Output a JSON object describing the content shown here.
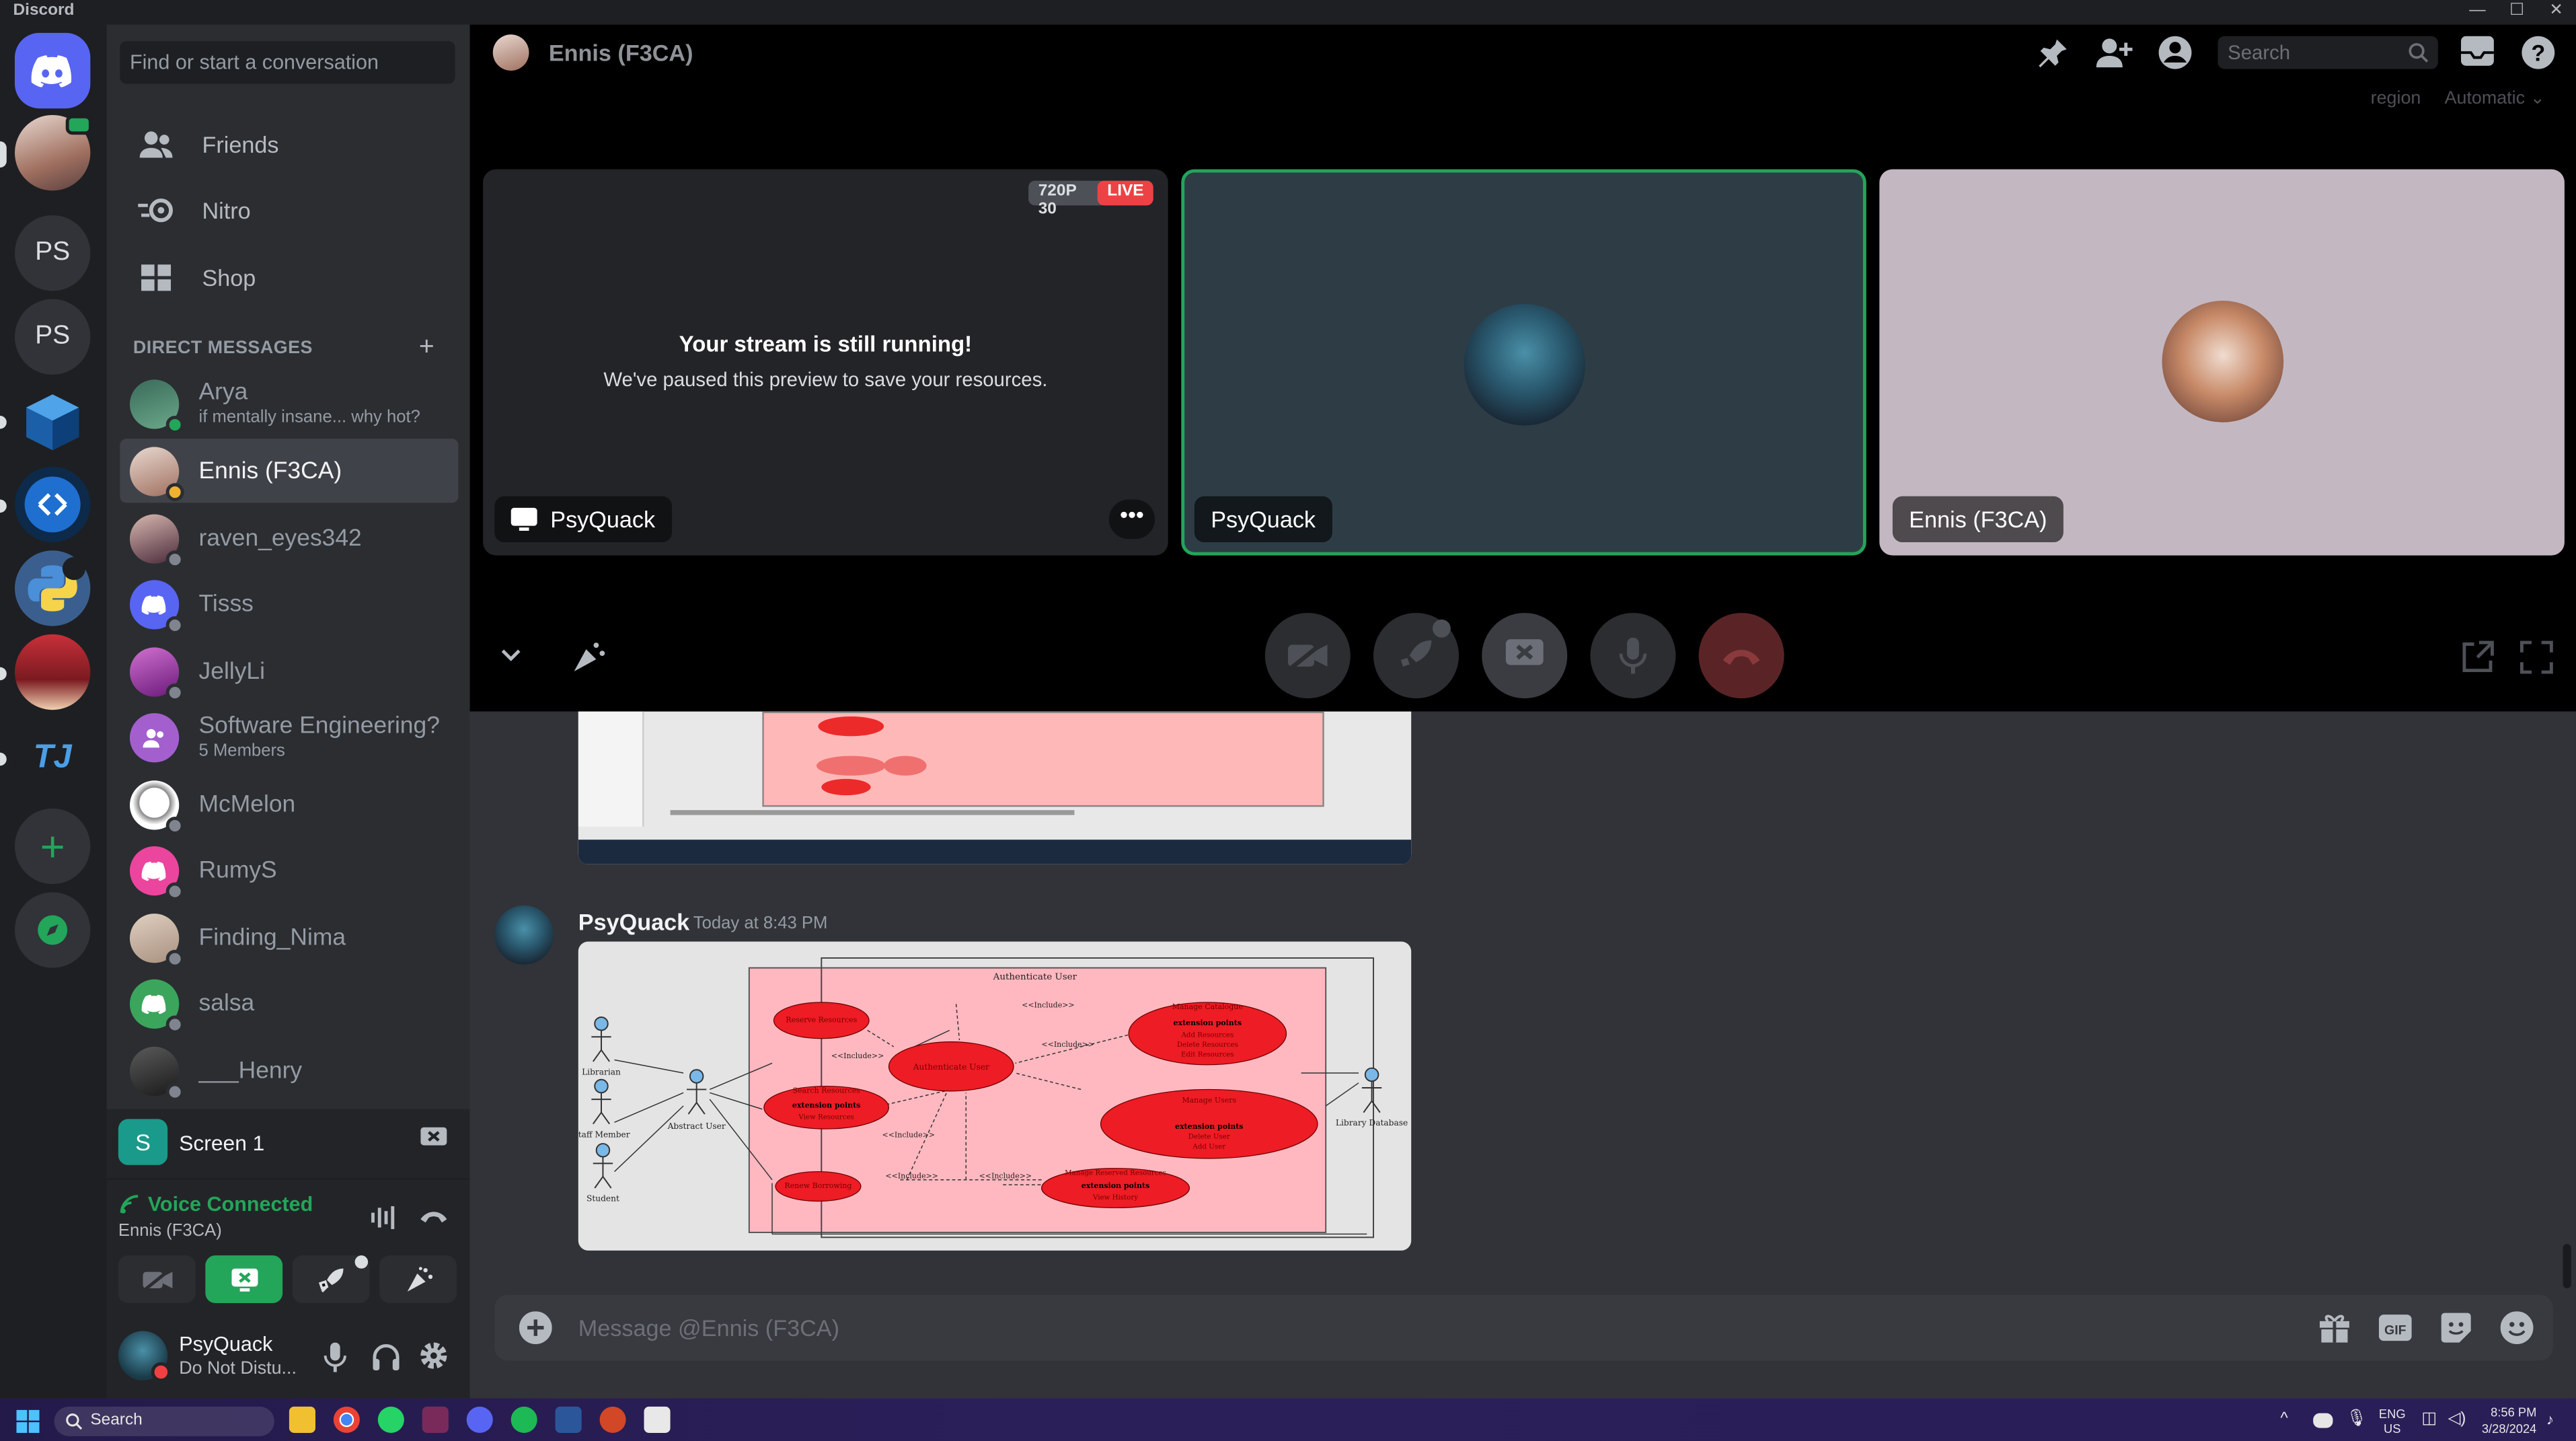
{
  "window": {
    "app_title": "Discord",
    "controls": [
      "—",
      "☐",
      "✕"
    ]
  },
  "servers": [
    {
      "label": "PS"
    },
    {
      "label": "PS"
    },
    {
      "label": "TJ"
    }
  ],
  "sidebar": {
    "search_placeholder": "Find or start a conversation",
    "nav": [
      {
        "label": "Friends",
        "icon": "friends-icon"
      },
      {
        "label": "Nitro",
        "icon": "nitro-icon"
      },
      {
        "label": "Shop",
        "icon": "shop-icon"
      }
    ],
    "dm_header": "DIRECT MESSAGES",
    "dms": [
      {
        "name": "Arya",
        "sub": "if mentally insane... why hot?",
        "color": "#4a7a6a",
        "status": "online"
      },
      {
        "name": "Ennis (F3CA)",
        "sub": "",
        "color": "#b08070",
        "status": "idle",
        "selected": true
      },
      {
        "name": "raven_eyes342",
        "sub": "",
        "color": "#6a4a5a",
        "status": "offline"
      },
      {
        "name": "Tisss",
        "sub": "",
        "color": "#5865f2",
        "status": "offline",
        "discord": true
      },
      {
        "name": "JellyLi",
        "sub": "",
        "color": "#a04aa0",
        "status": "offline"
      },
      {
        "name": "Software Engineering?",
        "sub": "5 Members",
        "color": "#a45fcf",
        "status": "",
        "group": true
      },
      {
        "name": "McMelon",
        "sub": "",
        "color": "#e8e8e8",
        "status": "offline"
      },
      {
        "name": "RumyS",
        "sub": "",
        "color": "#eb459e",
        "status": "offline",
        "discord": true
      },
      {
        "name": "Finding_Nima",
        "sub": "",
        "color": "#c8b8a8",
        "status": "offline"
      },
      {
        "name": "salsa",
        "sub": "",
        "color": "#3ba55c",
        "status": "offline",
        "discord": true
      },
      {
        "name": "___Henry",
        "sub": "",
        "color": "#3a3a3a",
        "status": "offline"
      }
    ],
    "screen_share": {
      "label": "Screen 1"
    },
    "voice": {
      "status": "Voice Connected",
      "channel": "Ennis (F3CA)"
    },
    "user": {
      "name": "PsyQuack",
      "status": "Do Not Distu..."
    }
  },
  "call": {
    "header_title": "Ennis (F3CA)",
    "search_placeholder": "Search",
    "region_label": "region",
    "region_value": "Automatic",
    "stream_tile": {
      "quality": "720P 30",
      "live": "LIVE",
      "title": "Your stream is still running!",
      "subtitle": "We've paused this preview to save your resources.",
      "name": "PsyQuack"
    },
    "tile2_name": "PsyQuack",
    "tile3_name": "Ennis (F3CA)"
  },
  "chat": {
    "message": {
      "author": "PsyQuack",
      "timestamp": "Today at 8:43 PM"
    },
    "diagram": {
      "system": "Authenticate User",
      "actors": [
        "Librarian",
        "Staff Member",
        "Abstract User",
        "Student",
        "Library Database"
      ],
      "usecases": [
        "Reserve Resources",
        "Authenticate User",
        "Manage Catalogue",
        "Search Resources",
        "Manage Users",
        "Renew Borrowing",
        "Manage Reserved Resources"
      ],
      "ext_label": "extension points",
      "include_label": "<<Include>>",
      "catalogue_points": [
        "Add Resources",
        "Delete Resources",
        "Edit Resources"
      ],
      "user_points": [
        "Delete User",
        "Add User"
      ],
      "search_point": "View Resources",
      "reserved_point": "View History"
    },
    "message_placeholder": "Message @Ennis (F3CA)"
  },
  "taskbar": {
    "search": "Search",
    "lang": "ENG",
    "region": "US",
    "time": "8:56 PM",
    "date": "3/28/2024"
  },
  "colors": {
    "blurple": "#5865f2",
    "green": "#23a55a",
    "red": "#ed4245",
    "dark": "#1e1f22"
  }
}
